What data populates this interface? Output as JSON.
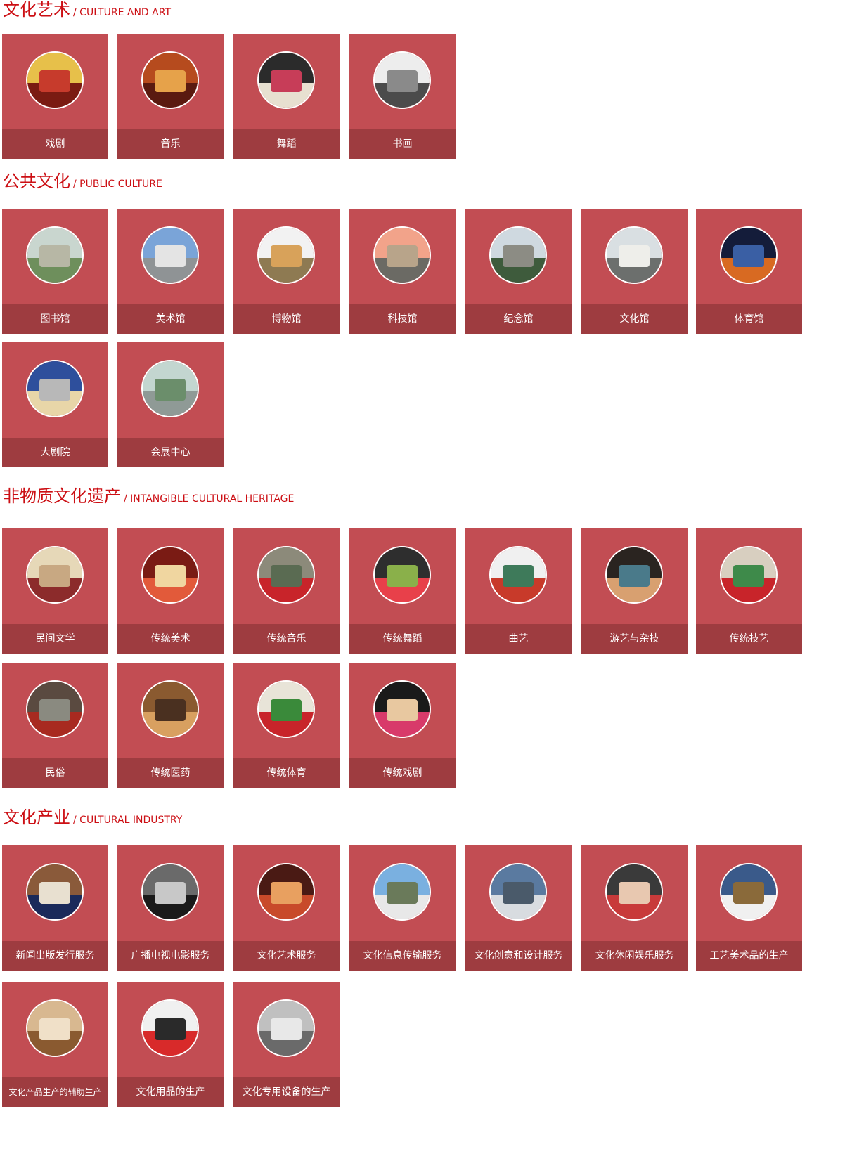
{
  "colors": {
    "heading": "#cc0f14",
    "card": "#c24d53",
    "card_label_bg": "#9e3c40",
    "card_text": "#ffffff"
  },
  "sections": [
    {
      "title_cn": "文化艺术",
      "title_en": "/ CULTURE AND ART",
      "items": [
        {
          "label": "戏剧",
          "photo": "peking-opera-photo",
          "tones": [
            "#e7c04a",
            "#7a1b12",
            "#c73b2c"
          ]
        },
        {
          "label": "音乐",
          "photo": "drum-performer-photo",
          "tones": [
            "#b64b1e",
            "#5a1a10",
            "#e6a24a"
          ]
        },
        {
          "label": "舞蹈",
          "photo": "folk-dance-photo",
          "tones": [
            "#2b2b2b",
            "#e7e0d0",
            "#c73d58"
          ]
        },
        {
          "label": "书画",
          "photo": "ink-painting-photo",
          "tones": [
            "#ededed",
            "#4b4b4b",
            "#8a8a8a"
          ]
        }
      ]
    },
    {
      "title_cn": "公共文化",
      "title_en": "/ PUBLIC CULTURE",
      "items": [
        {
          "label": "图书馆",
          "photo": "library-building-photo",
          "tones": [
            "#c9d6cf",
            "#6e8f5c",
            "#b7b7a5"
          ]
        },
        {
          "label": "美术馆",
          "photo": "art-museum-building-photo",
          "tones": [
            "#7aa4d8",
            "#8f9395",
            "#e4e4e4"
          ]
        },
        {
          "label": "博物馆",
          "photo": "museum-building-photo",
          "tones": [
            "#f2f2f2",
            "#8e7a52",
            "#d8a25a"
          ]
        },
        {
          "label": "科技馆",
          "photo": "science-museum-building-photo",
          "tones": [
            "#f2a38a",
            "#6b6a64",
            "#b8a48a"
          ]
        },
        {
          "label": "纪念馆",
          "photo": "memorial-hall-photo",
          "tones": [
            "#cfd9e0",
            "#3e5b3c",
            "#8c8c84"
          ]
        },
        {
          "label": "文化馆",
          "photo": "cultural-center-building-photo",
          "tones": [
            "#d9dfe2",
            "#6c6f6d",
            "#eeeeea"
          ]
        },
        {
          "label": "体育馆",
          "photo": "stadium-night-photo",
          "tones": [
            "#141c3a",
            "#d86a22",
            "#3a5fa4"
          ]
        },
        {
          "label": "大剧院",
          "photo": "grand-theater-photo",
          "tones": [
            "#2e4f9c",
            "#e8d6a8",
            "#b8b8b8"
          ]
        },
        {
          "label": "会展中心",
          "photo": "exhibition-center-photo",
          "tones": [
            "#c3d6d0",
            "#8f9a96",
            "#6b8e6b"
          ]
        }
      ]
    },
    {
      "title_cn": "非物质文化遗产",
      "title_en": "/ INTANGIBLE CULTURAL HERITAGE",
      "items": [
        {
          "label": "民间文学",
          "photo": "folk-literature-photo",
          "tones": [
            "#e6d8b8",
            "#8c2b2b",
            "#c8a882"
          ]
        },
        {
          "label": "传统美术",
          "photo": "traditional-art-photo",
          "tones": [
            "#7a1b14",
            "#e25a3a",
            "#f0d6a0"
          ]
        },
        {
          "label": "传统音乐",
          "photo": "traditional-music-photo",
          "tones": [
            "#8c8a7a",
            "#c8242a",
            "#5a6b52"
          ]
        },
        {
          "label": "传统舞蹈",
          "photo": "traditional-dance-photo",
          "tones": [
            "#2e2e2e",
            "#e8404a",
            "#8ab04a"
          ]
        },
        {
          "label": "曲艺",
          "photo": "folk-art-performance-photo",
          "tones": [
            "#f0f0f0",
            "#c83a2a",
            "#3e7a5a"
          ]
        },
        {
          "label": "游艺与杂技",
          "photo": "acrobatics-photo",
          "tones": [
            "#2a2420",
            "#d8a070",
            "#4a7a8a"
          ]
        },
        {
          "label": "传统技艺",
          "photo": "traditional-craft-photo",
          "tones": [
            "#d8cfc0",
            "#c8242a",
            "#3e8a4a"
          ]
        },
        {
          "label": "民俗",
          "photo": "folk-custom-photo",
          "tones": [
            "#5a4a40",
            "#a82a20",
            "#8a8a80"
          ]
        },
        {
          "label": "传统医药",
          "photo": "traditional-medicine-photo",
          "tones": [
            "#8a5a30",
            "#d8a060",
            "#4a3020"
          ]
        },
        {
          "label": "传统体育",
          "photo": "traditional-sports-photo",
          "tones": [
            "#e8e4d8",
            "#c8242a",
            "#3a8a3a"
          ]
        },
        {
          "label": "传统戏剧",
          "photo": "traditional-opera-photo",
          "tones": [
            "#1a1a1a",
            "#d83a6a",
            "#e8c8a0"
          ]
        }
      ]
    },
    {
      "title_cn": "文化产业",
      "title_en": "/ CULTURAL INDUSTRY",
      "items": [
        {
          "label": "新闻出版发行服务",
          "photo": "publishing-service-photo",
          "tones": [
            "#8a5a3a",
            "#1a2a5a",
            "#e8e0d0"
          ]
        },
        {
          "label": "广播电视电影服务",
          "photo": "broadcast-film-photo",
          "tones": [
            "#6a6a6a",
            "#1a1a1a",
            "#c8c8c8"
          ]
        },
        {
          "label": "文化艺术服务",
          "photo": "art-service-photo",
          "tones": [
            "#4a1a14",
            "#c84a2a",
            "#e8a060"
          ]
        },
        {
          "label": "文化信息传输服务",
          "photo": "information-transmission-photo",
          "tones": [
            "#7ab0e0",
            "#e8e8e8",
            "#6a7a5a"
          ]
        },
        {
          "label": "文化创意和设计服务",
          "photo": "creative-design-photo",
          "tones": [
            "#5a7aa0",
            "#d8dce0",
            "#4a5a6a"
          ]
        },
        {
          "label": "文化休闲娱乐服务",
          "photo": "leisure-entertainment-photo",
          "tones": [
            "#3a3a3a",
            "#c83a3a",
            "#e8c8b0"
          ]
        },
        {
          "label": "工艺美术品的生产",
          "photo": "craft-production-photo",
          "tones": [
            "#3a5a8a",
            "#f0f0f0",
            "#8a6a3a"
          ]
        },
        {
          "label": "文化产品生产的辅助生产",
          "photo": "auxiliary-production-photo",
          "tones": [
            "#d8b890",
            "#8a5a30",
            "#f0e0c8"
          ]
        },
        {
          "label": "文化用品的生产",
          "photo": "cultural-goods-production-photo",
          "tones": [
            "#f0f0f0",
            "#d82a2a",
            "#2a2a2a"
          ]
        },
        {
          "label": "文化专用设备的生产",
          "photo": "special-equipment-production-photo",
          "tones": [
            "#c0c0c0",
            "#6a6a6a",
            "#e8e8e8"
          ]
        }
      ]
    }
  ]
}
